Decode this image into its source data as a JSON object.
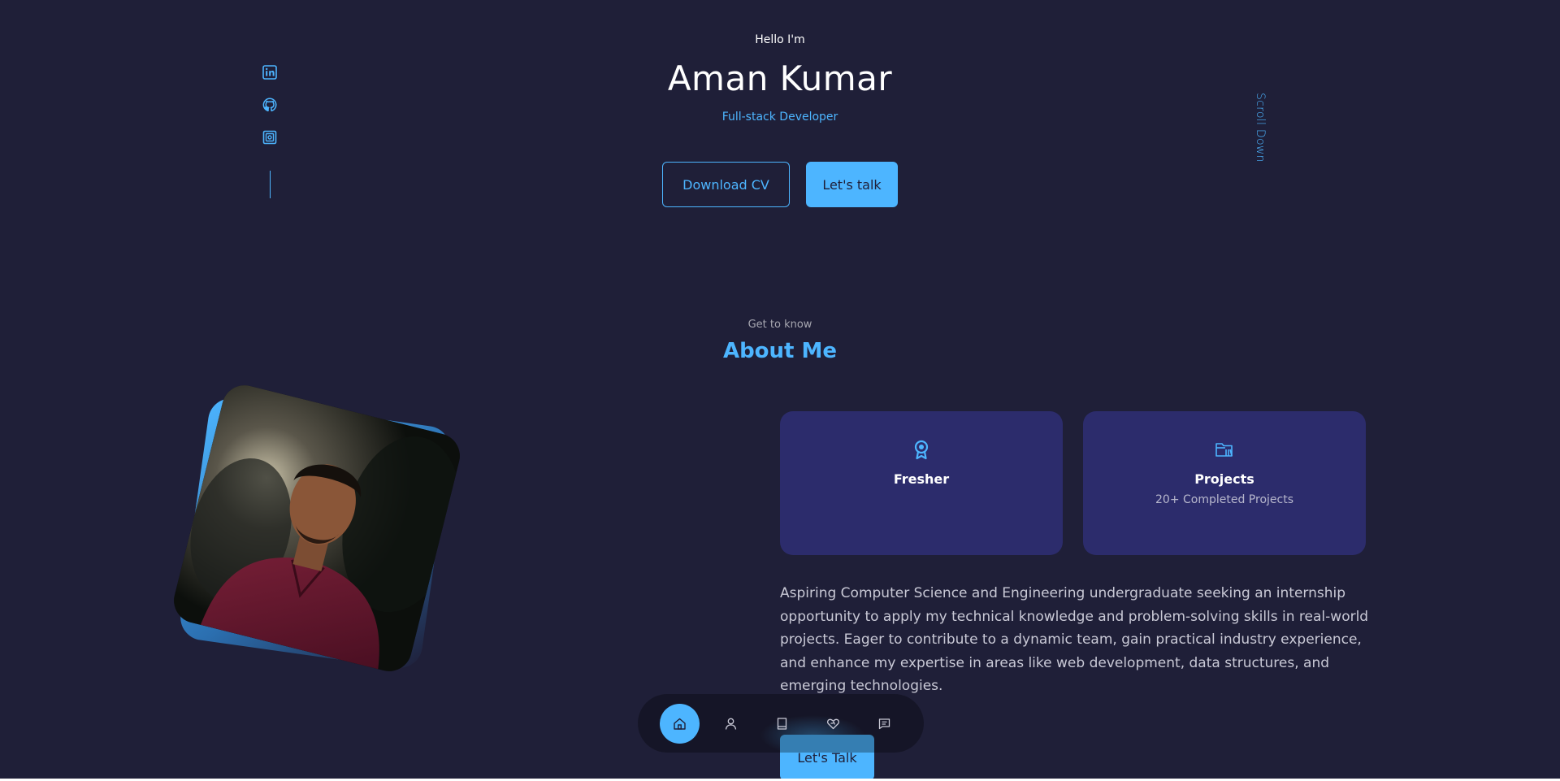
{
  "header": {
    "greeting": "Hello I'm",
    "name": "Aman Kumar",
    "role": "Full-stack Developer",
    "download_cv_label": "Download CV",
    "lets_talk_label": "Let's talk"
  },
  "socials": {
    "icons": [
      "linkedin-icon",
      "github-icon",
      "instagram-icon"
    ]
  },
  "scroll_down_label": "Scroll Down",
  "about": {
    "eyebrow": "Get to know",
    "title": "About Me",
    "cards": [
      {
        "icon": "award-icon",
        "title": "Fresher",
        "subtitle": ""
      },
      {
        "icon": "folder-icon",
        "title": "Projects",
        "subtitle": "20+ Completed Projects"
      }
    ],
    "paragraph": "Aspiring Computer Science and Engineering undergraduate seeking an internship opportunity to apply my technical knowledge and problem-solving skills in real-world projects. Eager to contribute to a dynamic team, gain practical industry experience, and enhance my expertise in areas like web development, data structures, and emerging technologies.",
    "cta_label": "Let's Talk"
  },
  "bottom_nav": {
    "items": [
      {
        "icon": "home-icon",
        "active": true
      },
      {
        "icon": "user-icon",
        "active": false
      },
      {
        "icon": "book-icon",
        "active": false
      },
      {
        "icon": "services-icon",
        "active": false
      },
      {
        "icon": "message-icon",
        "active": false
      }
    ]
  },
  "colors": {
    "background": "#1f1f38",
    "accent": "#4db5ff",
    "card": "#2c2c6c"
  }
}
